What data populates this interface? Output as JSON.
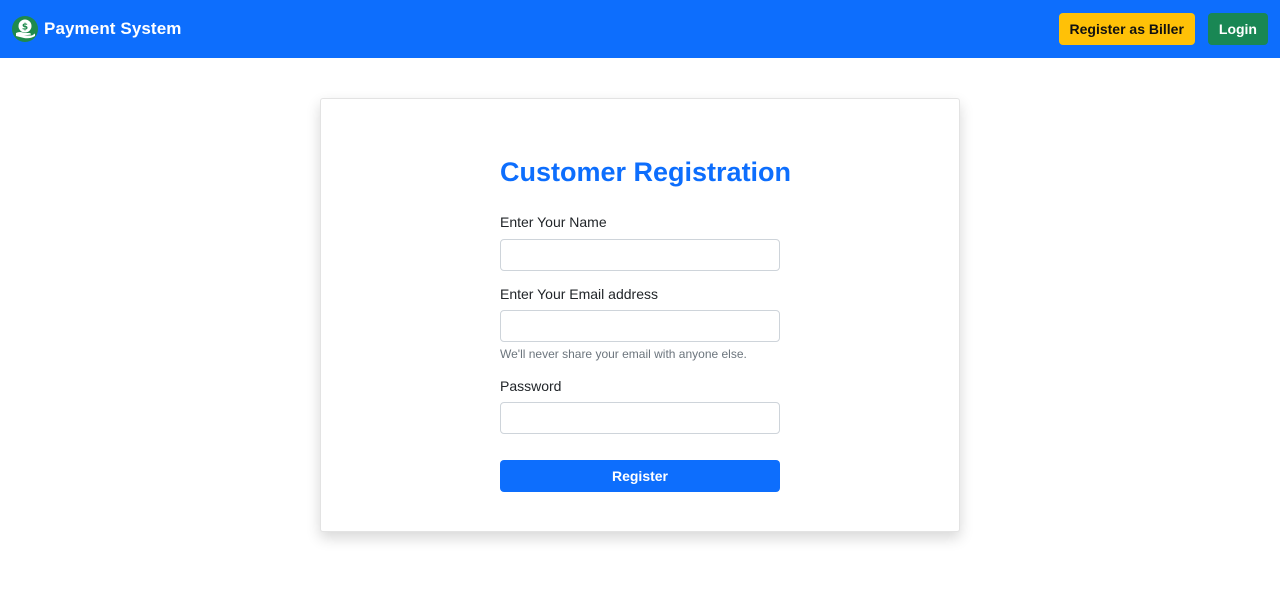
{
  "navbar": {
    "brand_text": "Payment System",
    "brand_icon": "money-hand-icon",
    "register_biller_label": "Register as Biller",
    "login_label": "Login"
  },
  "form": {
    "title": "Customer Registration",
    "name_label": "Enter Your Name",
    "name_value": "",
    "email_label": "Enter Your Email address",
    "email_value": "",
    "email_help": "We'll never share your email with anyone else.",
    "password_label": "Password",
    "password_value": "",
    "submit_label": "Register"
  },
  "colors": {
    "primary": "#0d6efd",
    "warning": "#ffc107",
    "success": "#198754"
  }
}
